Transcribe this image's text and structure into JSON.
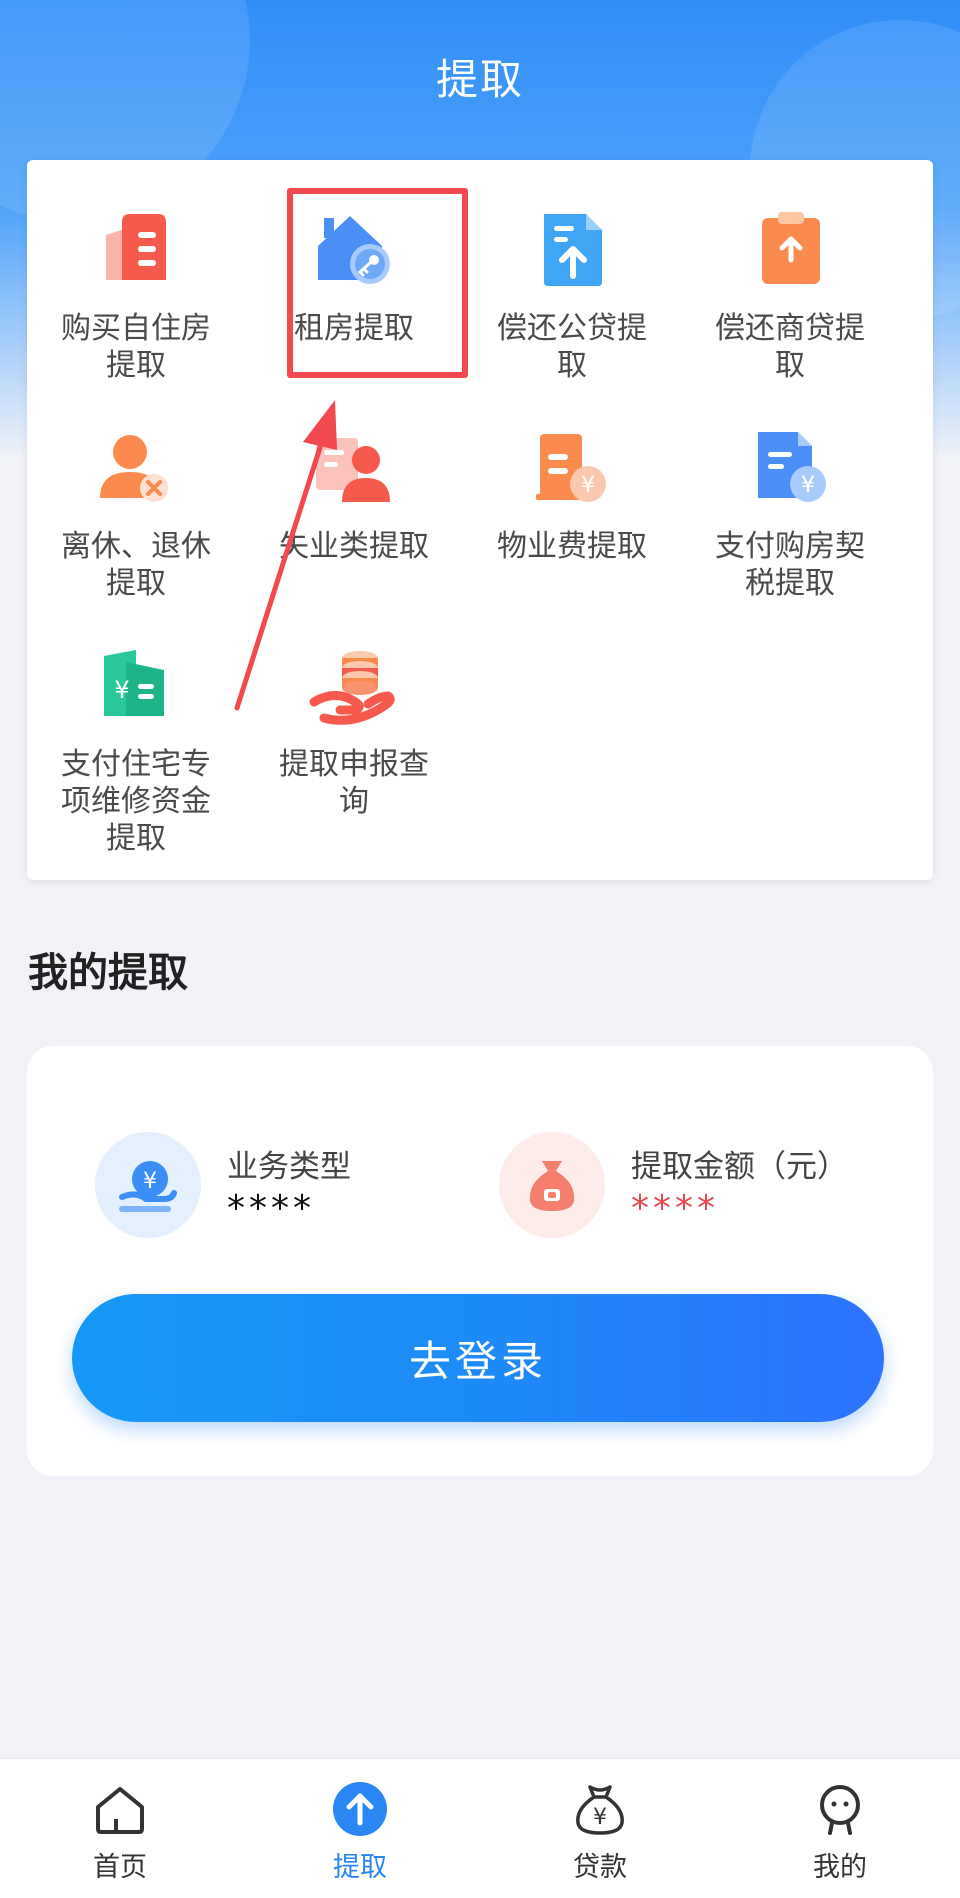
{
  "header": {
    "title": "提取"
  },
  "services": [
    {
      "label": "购买自住房提取",
      "icon": "building-document-icon"
    },
    {
      "label": "租房提取",
      "icon": "house-key-icon"
    },
    {
      "label": "偿还公贷提取",
      "icon": "document-upload-icon"
    },
    {
      "label": "偿还商贷提取",
      "icon": "clipboard-upload-icon"
    },
    {
      "label": "离休、退休提取",
      "icon": "person-cancel-icon"
    },
    {
      "label": "失业类提取",
      "icon": "person-list-icon"
    },
    {
      "label": "物业费提取",
      "icon": "building-yuan-icon"
    },
    {
      "label": "支付购房契税提取",
      "icon": "document-yuan-icon"
    },
    {
      "label": "支付住宅专项维修资金提取",
      "icon": "building-yuan-card-icon"
    },
    {
      "label": "提取申报查询",
      "icon": "hand-coins-icon"
    }
  ],
  "my_section": {
    "title": "我的提取",
    "business_type_label": "业务类型",
    "business_type_value": "****",
    "amount_label": "提取金额（元）",
    "amount_value": "****",
    "login_button": "去登录"
  },
  "tabbar": [
    {
      "label": "首页",
      "icon": "home-icon",
      "active": false
    },
    {
      "label": "提取",
      "icon": "arrow-up-circle-icon",
      "active": true
    },
    {
      "label": "贷款",
      "icon": "money-bag-icon",
      "active": false
    },
    {
      "label": "我的",
      "icon": "user-icon",
      "active": false
    }
  ],
  "colors": {
    "primary": "#2a86f5",
    "highlight": "#f2484f",
    "amount_value": "#e8474f",
    "orange": "#fa7a5a",
    "blue": "#3a8ef6"
  }
}
